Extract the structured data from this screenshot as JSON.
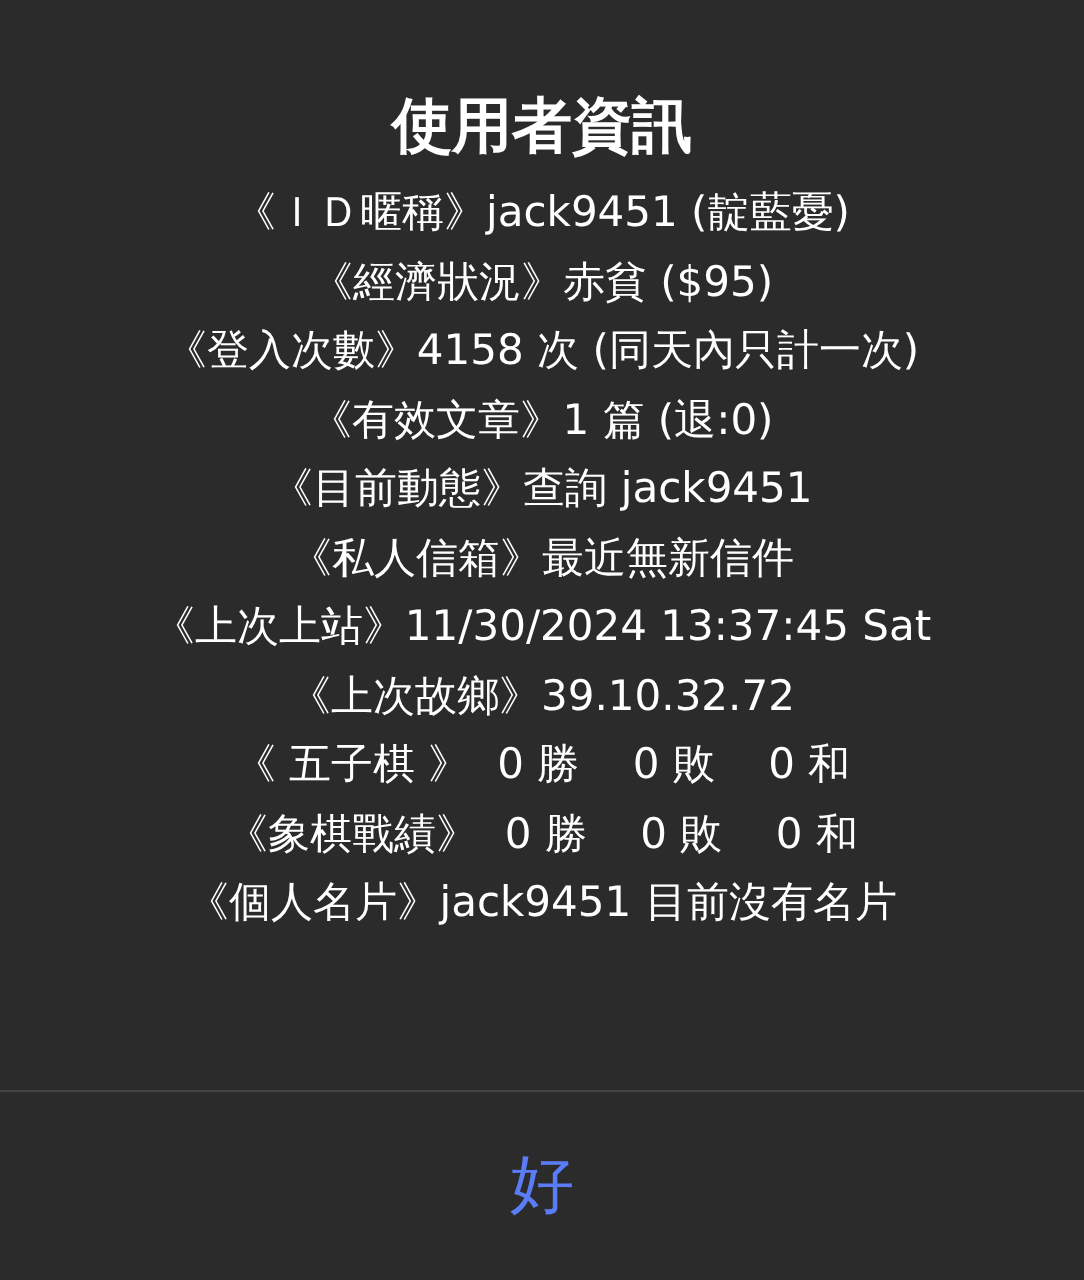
{
  "alert": {
    "title": "使用者資訊",
    "lines": [
      "《ＩＤ暱稱》jack9451 (靛藍憂)",
      "《經濟狀況》赤貧 ($95)",
      "《登入次數》4158 次 (同天內只計一次)",
      "《有效文章》1 篇 (退:0)",
      "《目前動態》查詢 jack9451",
      "《私人信箱》最近無新信件",
      "《上次上站》11/30/2024 13:37:45 Sat",
      "《上次故鄉》39.10.32.72",
      "《 五子棋 》  0 勝    0 敗    0 和",
      "《象棋戰績》  0 勝    0 敗    0 和",
      "《個人名片》jack9451 目前沒有名片"
    ],
    "buttons": [
      "好"
    ]
  }
}
